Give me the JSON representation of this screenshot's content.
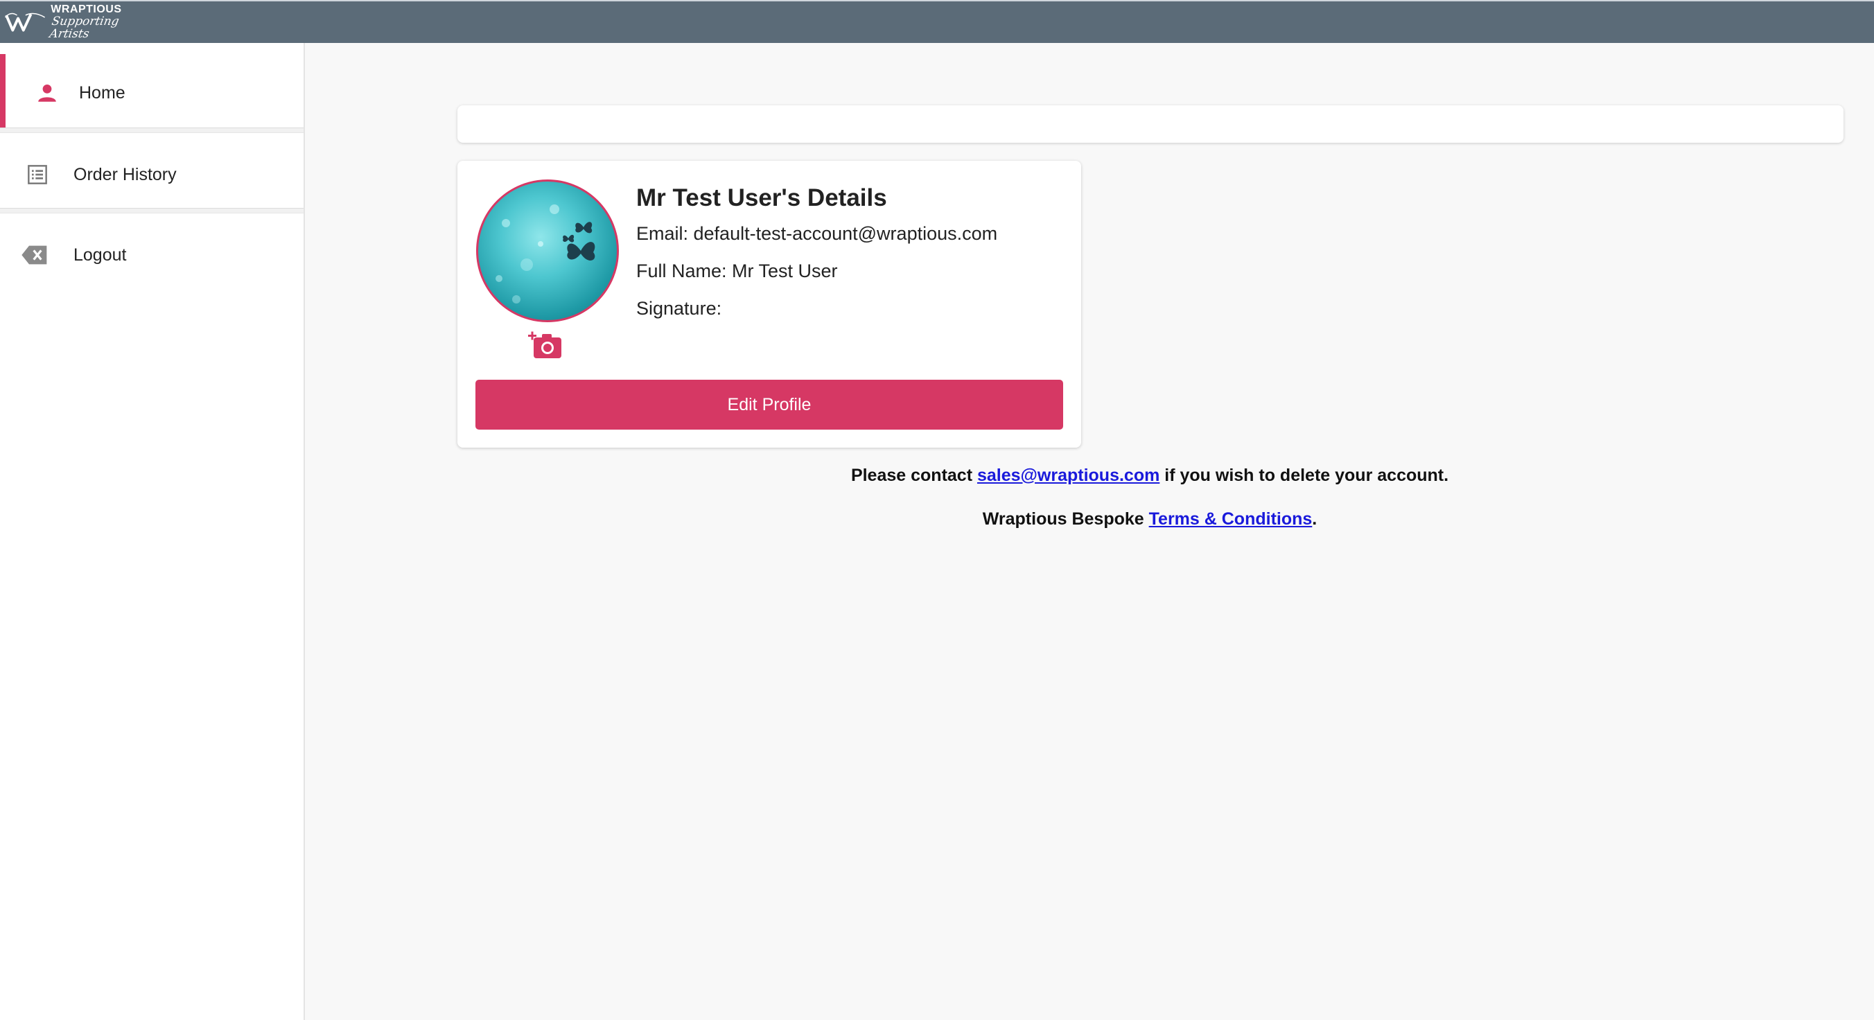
{
  "header": {
    "logo_word": "WRAPTIOUS",
    "logo_tagline": "Supporting Artists"
  },
  "sidebar": {
    "items": [
      {
        "label": "Home",
        "icon": "person-icon",
        "active": true
      },
      {
        "label": "Order History",
        "icon": "list-icon",
        "active": false
      },
      {
        "label": "Logout",
        "icon": "backspace-icon",
        "active": false
      }
    ]
  },
  "profile": {
    "title": "Mr Test User's Details",
    "email_label": "Email: default-test-account@wraptious.com",
    "fullname_label": "Full Name: Mr Test User",
    "signature_label": "Signature:",
    "edit_button": "Edit Profile"
  },
  "footer": {
    "contact_prefix": "Please contact ",
    "contact_email": "sales@wraptious.com",
    "contact_suffix": " if you wish to delete your account.",
    "terms_prefix": "Wraptious Bespoke ",
    "terms_link": "Terms & Conditions",
    "terms_suffix": "."
  },
  "colors": {
    "accent": "#d63864",
    "topbar": "#5b6b78",
    "link": "#1a1adb"
  }
}
